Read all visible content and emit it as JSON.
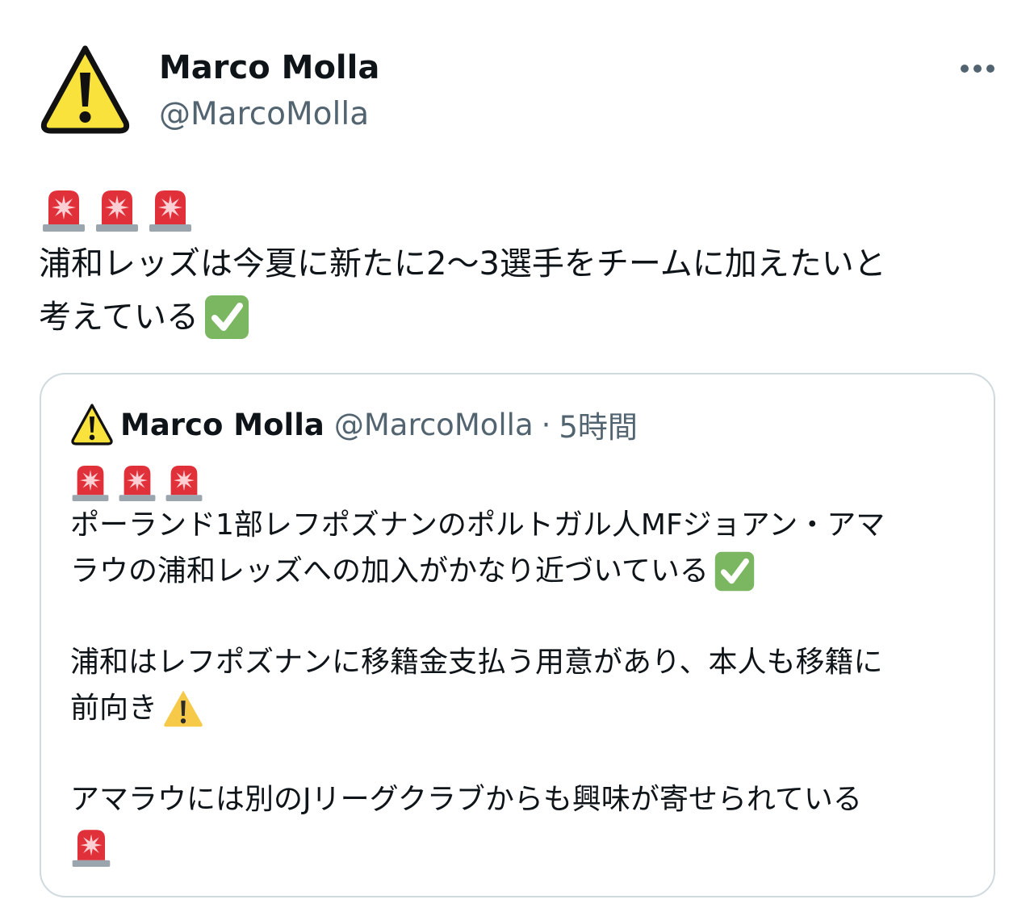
{
  "author": {
    "name": "Marco Molla",
    "handle": "@MarcoMolla",
    "avatar_icon": "warning-sign-icon"
  },
  "more_icon": "more-options-icon",
  "tweet": {
    "emojis": [
      "police-siren-icon",
      "police-siren-icon",
      "police-siren-icon"
    ],
    "lines": [
      "浦和レッズは今夏に新たに2〜3選手をチームに加えたいと",
      "考えている"
    ],
    "trailing_emoji": "check-mark-button-icon"
  },
  "quoted_tweet": {
    "name": "Marco Molla",
    "handle": "@MarcoMolla",
    "separator": "·",
    "time": "5時間",
    "emojis": [
      "police-siren-icon",
      "police-siren-icon",
      "police-siren-icon"
    ],
    "paragraph1": [
      "ポーランド1部レフポズナンのポルトガル人MFジョアン・アマ",
      "ラウの浦和レッズへの加入がかなり近づいている"
    ],
    "paragraph2": [
      "浦和はレフポズナンに移籍金支払う用意があり、本人も移籍に",
      "前向き"
    ],
    "paragraph3": [
      "アマラウには別のJリーグクラブからも興味が寄せられている"
    ],
    "final_emoji": "police-siren-icon"
  },
  "colors": {
    "text": "#0f1419",
    "secondary": "#536471",
    "border": "#cfd9de",
    "siren_red": "#e0303a",
    "check_green": "#7bb661",
    "warning_yellow": "#f9e23b"
  }
}
